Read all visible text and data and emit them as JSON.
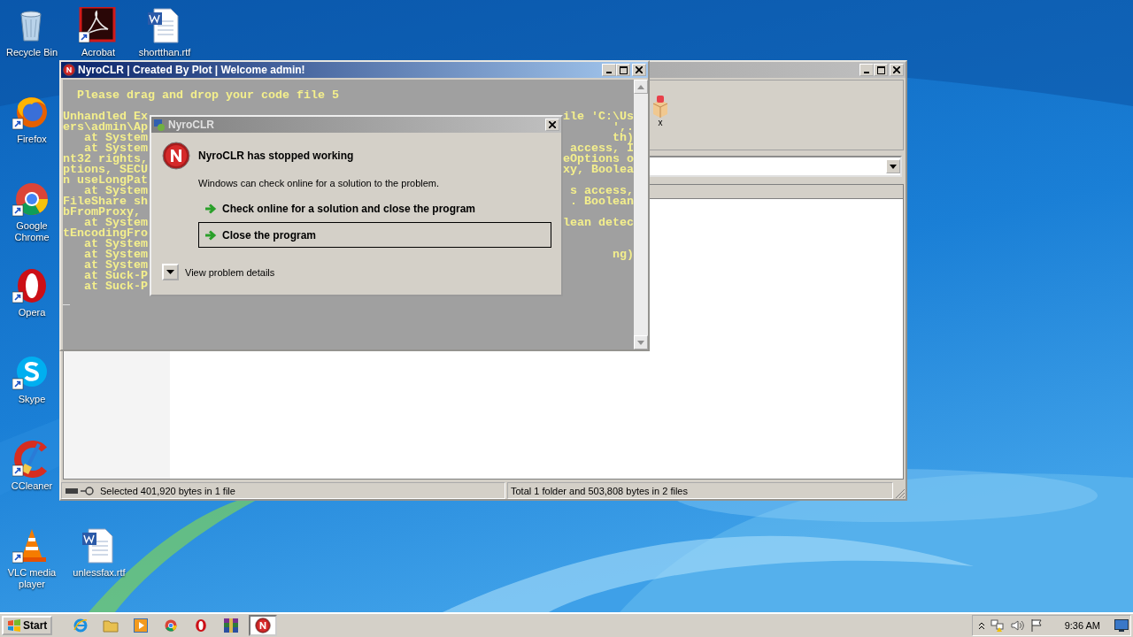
{
  "desktop_icons": [
    {
      "label": "Recycle Bin",
      "kind": "recycle",
      "shortcut": false
    },
    {
      "label": "Acrobat",
      "kind": "acrobat",
      "shortcut": true
    },
    {
      "label": "shortthan.rtf",
      "kind": "word",
      "shortcut": false
    },
    {
      "label": "Firefox",
      "kind": "firefox",
      "shortcut": true
    },
    {
      "label": "Google Chrome",
      "kind": "chrome",
      "shortcut": true
    },
    {
      "label": "Opera",
      "kind": "opera",
      "shortcut": true
    },
    {
      "label": "Skype",
      "kind": "skype",
      "shortcut": true
    },
    {
      "label": "CCleaner",
      "kind": "ccleaner",
      "shortcut": true
    },
    {
      "label": "VLC media player",
      "kind": "vlc",
      "shortcut": true
    },
    {
      "label": "unlessfax.rtf",
      "kind": "word",
      "shortcut": false
    }
  ],
  "back_window": {
    "toolbar_label": "x",
    "status_left": "Selected 401,920 bytes in 1 file",
    "status_right": "Total 1 folder and 503,808 bytes in 2 files"
  },
  "console_window": {
    "title": "NyroCLR | Created By Plot | Welcome admin!",
    "prompt": "  Please drag and drop your code file 5",
    "lines": [
      {
        "left": "Unhandled Ex",
        "right": "ile 'C:\\Us"
      },
      {
        "left": "ers\\admin\\Ap",
        "right": "',."
      },
      {
        "left": "   at System",
        "right": "th)"
      },
      {
        "left": "   at System",
        "right": "access, I"
      },
      {
        "left": "nt32 rights,",
        "right": "eOptions o"
      },
      {
        "left": "ptions, SECU",
        "right": "xy, Boolea"
      },
      {
        "left": "n useLongPat"
      },
      {
        "left": "   at System",
        "right": "s access,"
      },
      {
        "left": "FileShare sh",
        "right": ". Boolean"
      },
      {
        "left": "bFromProxy,"
      },
      {
        "left": "   at System",
        "right": "lean detec"
      },
      {
        "left": "tEncodingFro"
      },
      {
        "left": "   at System"
      },
      {
        "left": "   at System",
        "right": "ng)"
      },
      {
        "left": "   at System"
      },
      {
        "left": "   at Suck-P"
      },
      {
        "left": "   at Suck-P"
      }
    ],
    "cursor": "_"
  },
  "dialog": {
    "title": "NyroCLR",
    "heading": "NyroCLR has stopped working",
    "message": "Windows can check online for a solution to the problem.",
    "options": [
      {
        "label": "Check online for a solution and close the program",
        "selected": false
      },
      {
        "label": "Close the program",
        "selected": true
      }
    ],
    "details": "View problem details"
  },
  "taskbar": {
    "start": "Start",
    "apps": [
      {
        "kind": "ie",
        "selected": false
      },
      {
        "kind": "folder",
        "selected": false
      },
      {
        "kind": "media",
        "selected": false
      },
      {
        "kind": "chrome",
        "selected": false
      },
      {
        "kind": "opera",
        "selected": false
      },
      {
        "kind": "winrar",
        "selected": false
      },
      {
        "kind": "nyro",
        "selected": true
      }
    ],
    "clock": "9:36 AM"
  }
}
